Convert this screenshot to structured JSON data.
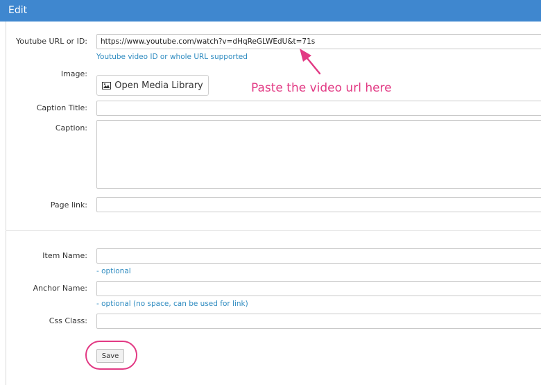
{
  "dialog": {
    "title": "Edit"
  },
  "form": {
    "youtube": {
      "label": "Youtube URL or ID:",
      "value": "https://www.youtube.com/watch?v=dHqReGLWEdU&t=71s",
      "hint": "Youtube video ID or whole URL supported"
    },
    "image": {
      "label": "Image:",
      "button_label": "Open Media Library",
      "button_icon": "image-icon"
    },
    "caption_title": {
      "label": "Caption Title:",
      "value": ""
    },
    "caption": {
      "label": "Caption:",
      "value": ""
    },
    "page_link": {
      "label": "Page link:",
      "value": ""
    },
    "item_name": {
      "label": "Item Name:",
      "value": "",
      "hint": "- optional"
    },
    "anchor_name": {
      "label": "Anchor Name:",
      "value": "",
      "hint": "- optional (no space, can be used for link)"
    },
    "css_class": {
      "label": "Css Class:",
      "value": ""
    },
    "save_label": "Save"
  },
  "annotation": {
    "text": "Paste the video url here",
    "color": "#e23a84"
  },
  "colors": {
    "titlebar": "#3f87cf",
    "hint": "#2e8bc0",
    "annotation": "#e23a84"
  }
}
